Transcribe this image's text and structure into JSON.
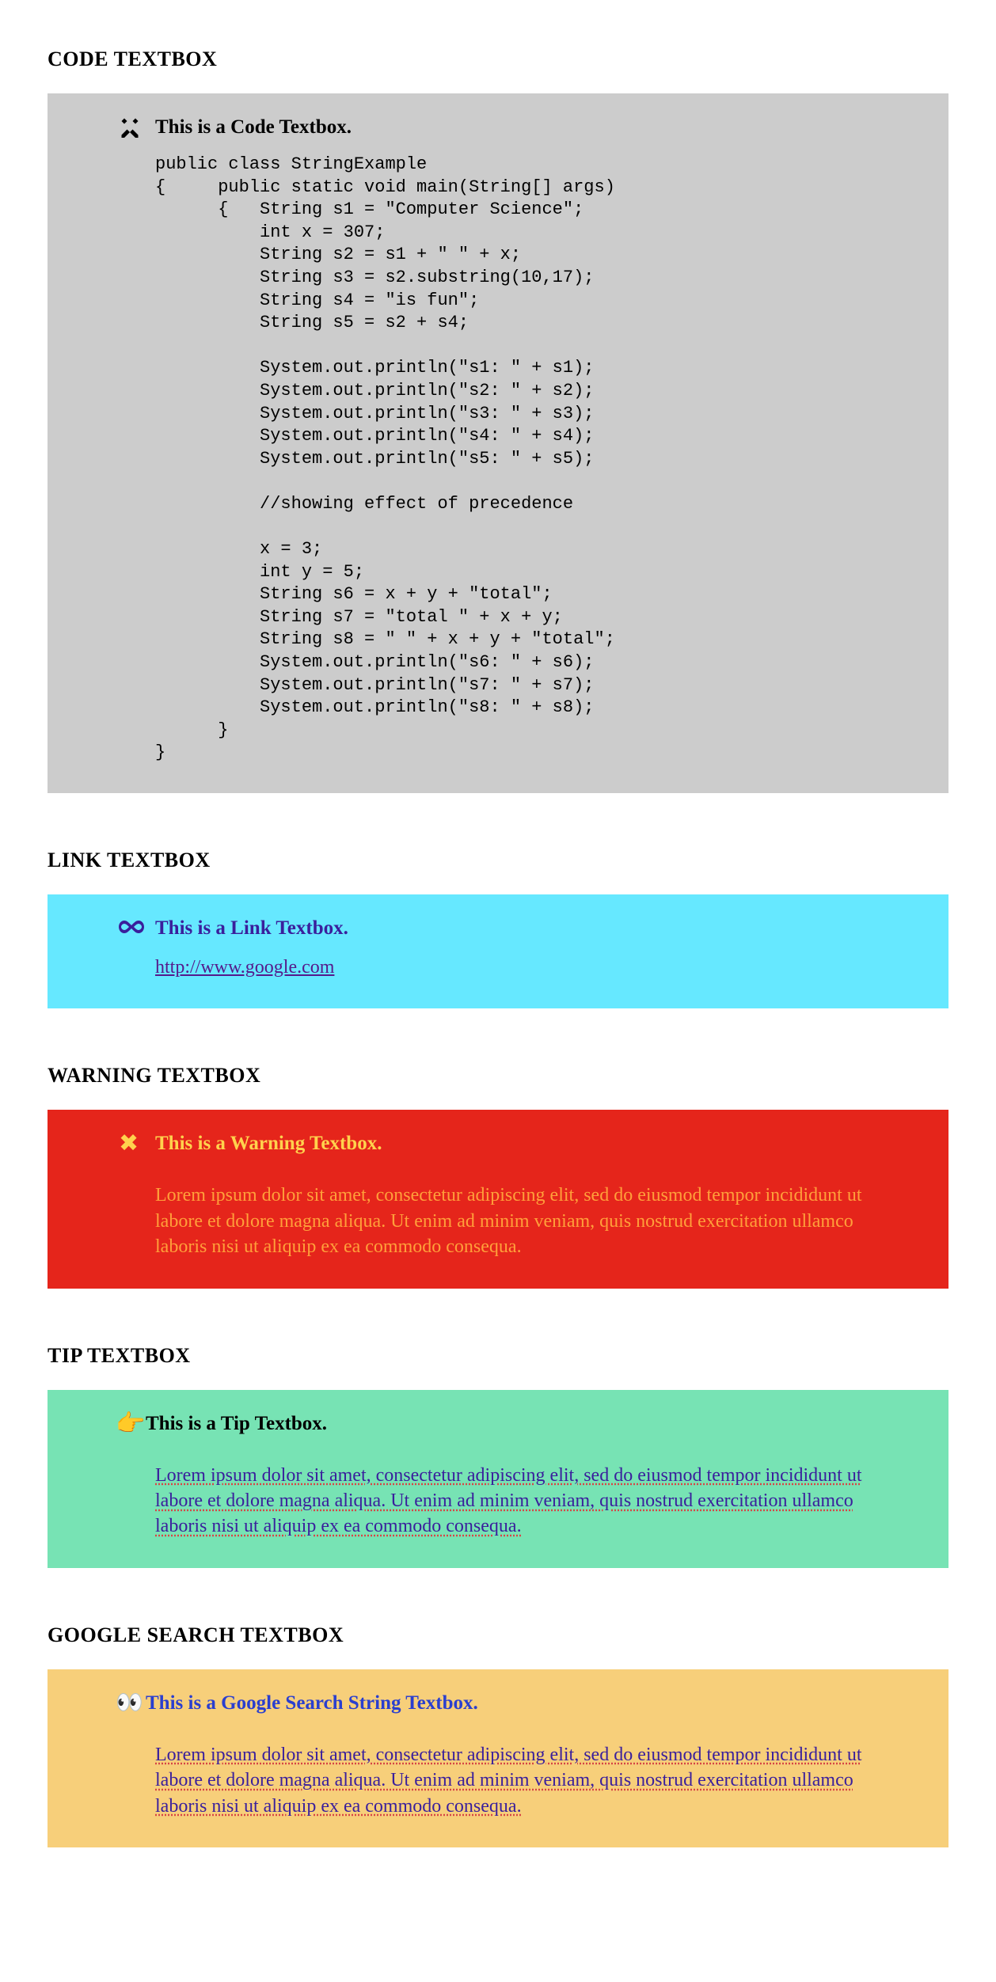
{
  "code": {
    "heading": "CODE TEXTBOX",
    "title": "This is a Code Textbox.",
    "icon_name": "tools-icon",
    "content": "public class StringExample\n{     public static void main(String[] args)\n      {   String s1 = \"Computer Science\";\n          int x = 307;\n          String s2 = s1 + \" \" + x;\n          String s3 = s2.substring(10,17);\n          String s4 = \"is fun\";\n          String s5 = s2 + s4;\n\n          System.out.println(\"s1: \" + s1);\n          System.out.println(\"s2: \" + s2);\n          System.out.println(\"s3: \" + s3);\n          System.out.println(\"s4: \" + s4);\n          System.out.println(\"s5: \" + s5);\n\n          //showing effect of precedence\n\n          x = 3;\n          int y = 5;\n          String s6 = x + y + \"total\";\n          String s7 = \"total \" + x + y;\n          String s8 = \" \" + x + y + \"total\";\n          System.out.println(\"s6: \" + s6);\n          System.out.println(\"s7: \" + s7);\n          System.out.println(\"s8: \" + s8);\n      }\n}"
  },
  "link": {
    "heading": "LINK TEXTBOX",
    "title": "This is  a Link Textbox.",
    "icon_name": "infinity-icon",
    "url_text": "http://www.google.com"
  },
  "warning": {
    "heading": "WARNING TEXTBOX",
    "title": "This is  a Warning Textbox.",
    "icon_name": "cross-icon",
    "body": "Lorem ipsum dolor sit amet, consectetur adipiscing elit, sed do eiusmod tempor incididunt ut labore et dolore magna aliqua. Ut enim ad minim veniam, quis nostrud exercitation ullamco laboris nisi ut aliquip ex ea commodo consequa."
  },
  "tip": {
    "heading": "TIP TEXTBOX",
    "title": "This is  a Tip Textbox.",
    "icon_name": "pointing-hand-icon",
    "body": "Lorem ipsum dolor sit amet, consectetur adipiscing elit, sed do eiusmod tempor incididunt ut labore et dolore magna aliqua. Ut enim ad minim veniam, quis nostrud exercitation ullamco laboris nisi ut aliquip ex ea commodo consequa."
  },
  "google": {
    "heading": "GOOGLE SEARCH TEXTBOX",
    "title": "This is  a Google Search String Textbox.",
    "icon_name": "eyes-icon",
    "body": "Lorem ipsum dolor sit amet, consectetur adipiscing elit, sed do eiusmod tempor incididunt ut labore et dolore magna aliqua. Ut enim ad minim veniam, quis nostrud exercitation ullamco laboris nisi ut aliquip ex ea commodo consequa."
  }
}
